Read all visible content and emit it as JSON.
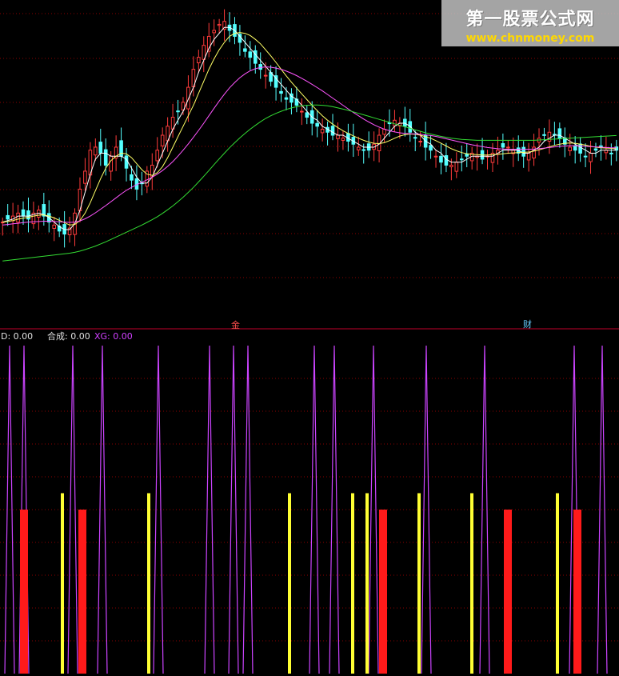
{
  "watermark": {
    "title": "第一股票公式网",
    "url": "www.chnmoney.com"
  },
  "markers": {
    "left": "金",
    "right": "财"
  },
  "indicator_header": {
    "d_label": "D: 0.00",
    "hecheng_label": "合成: 0.00",
    "xg_label": "XG: 0.00"
  },
  "colors": {
    "background": "#000000",
    "candle_up": "#ff3b3b",
    "candle_down": "#54ffff",
    "ma_short": "#ffffff",
    "ma_mid": "#ffff66",
    "ma_long": "#ff55ff",
    "ma_very_long": "#33dd33",
    "grid": "#8b0000",
    "spike_line": "#cc44ff",
    "signal_yellow": "#ffff33",
    "signal_red": "#ff1a1a"
  },
  "chart_data": [
    {
      "type": "candlestick",
      "title": "",
      "grid": true,
      "series": [
        {
          "name": "price",
          "close": [
            33,
            34,
            35,
            36,
            35,
            34,
            36,
            37,
            35,
            33,
            32,
            30,
            29,
            31,
            36,
            44,
            50,
            57,
            58,
            56,
            52,
            55,
            58,
            55,
            51,
            47,
            44,
            46,
            50,
            52,
            57,
            62,
            65,
            68,
            70,
            73,
            78,
            84,
            88,
            92,
            95,
            97,
            99,
            100,
            97,
            95,
            93,
            90,
            88,
            86,
            84,
            82,
            80,
            78,
            76,
            74,
            73,
            72,
            70,
            68,
            66,
            65,
            64,
            63,
            62,
            62,
            61,
            60,
            59,
            58,
            57,
            57,
            59,
            62,
            64,
            66,
            67,
            66,
            65,
            63,
            61,
            60,
            58,
            57,
            55,
            53,
            52,
            52,
            53,
            54,
            55,
            56,
            55,
            54,
            55,
            56,
            57,
            58,
            58,
            57,
            56,
            55,
            56,
            58,
            61,
            62,
            63,
            62,
            61,
            59,
            58,
            57,
            56,
            55,
            56,
            57,
            58,
            57,
            56,
            57
          ]
        },
        {
          "name": "ma_short",
          "values": [
            33,
            33.5,
            34,
            35,
            35,
            35,
            35.5,
            36,
            35.5,
            34.5,
            33,
            31.5,
            30.5,
            30.5,
            32.5,
            37,
            43,
            49,
            54,
            56,
            56,
            55,
            55,
            55,
            54,
            51,
            48,
            46,
            46,
            48,
            52,
            56,
            60,
            64,
            67,
            70,
            74,
            78,
            83,
            87,
            91,
            94,
            96,
            98,
            98,
            97,
            95,
            93,
            91,
            89,
            87,
            85,
            83,
            81,
            79,
            77,
            75,
            74,
            72,
            70,
            68,
            67,
            65,
            64,
            63,
            62,
            62,
            61,
            60,
            59,
            58,
            58,
            58,
            59,
            61,
            63,
            65,
            66,
            66,
            65,
            63,
            62,
            60,
            59,
            57,
            56,
            54,
            53,
            53,
            53,
            54,
            55,
            55,
            55,
            55,
            55,
            56,
            57,
            57,
            57,
            57,
            56,
            56,
            57,
            58,
            60,
            61,
            62,
            62,
            61,
            60,
            59,
            58,
            57,
            56,
            56,
            57,
            57,
            57,
            57
          ]
        },
        {
          "name": "ma_mid",
          "values": [
            33,
            33.2,
            33.5,
            34,
            34.3,
            34.6,
            35,
            35.3,
            35.4,
            35,
            34.4,
            33.6,
            32.8,
            32,
            32.2,
            33.5,
            36,
            39.5,
            43.5,
            47.5,
            51,
            53.5,
            55,
            56,
            55.8,
            54.5,
            52.5,
            50.5,
            49,
            48.6,
            49.5,
            51.5,
            54.5,
            58,
            61.5,
            65,
            68.5,
            72,
            76,
            80,
            84,
            87.5,
            90.5,
            93,
            95,
            96,
            96.3,
            96,
            95.3,
            94,
            92.5,
            90.5,
            88.5,
            86.3,
            84,
            81.8,
            79.7,
            77.7,
            75.8,
            73.9,
            72,
            70.2,
            68.5,
            67,
            65.7,
            64.5,
            63.5,
            62.6,
            61.8,
            61,
            60.3,
            59.7,
            59.3,
            59.2,
            59.5,
            60.2,
            61,
            61.7,
            62.2,
            62.4,
            62.3,
            62,
            61.5,
            61,
            60.2,
            59.3,
            58.4,
            57.5,
            56.8,
            56.2,
            55.8,
            55.6,
            55.5,
            55.4,
            55.4,
            55.5,
            55.6,
            55.8,
            56,
            56.1,
            56.2,
            56.3,
            56.4,
            56.7,
            57.1,
            57.6,
            58.1,
            58.6,
            59,
            59.3,
            59.4,
            59.3,
            59,
            58.7,
            58.3,
            58,
            57.8,
            57.7,
            57.6,
            57.5
          ]
        },
        {
          "name": "ma_long",
          "values": [
            32,
            32.2,
            32.4,
            32.6,
            32.8,
            33,
            33.1,
            33.2,
            33.3,
            33.3,
            33.2,
            33.1,
            33,
            32.9,
            33,
            33.4,
            34.1,
            35,
            36.1,
            37.3,
            38.5,
            39.8,
            41.1,
            42.4,
            43.6,
            44.6,
            45.5,
            46.3,
            47.1,
            48,
            49,
            50.2,
            51.6,
            53.2,
            55,
            57,
            59.1,
            61.3,
            63.6,
            66,
            68.5,
            71,
            73.4,
            75.7,
            77.8,
            79.6,
            81.2,
            82.5,
            83.5,
            84.2,
            84.6,
            84.8,
            84.7,
            84.4,
            84,
            83.4,
            82.7,
            81.9,
            81,
            80,
            79,
            77.9,
            76.8,
            75.6,
            74.4,
            73.2,
            72,
            70.8,
            69.6,
            68.5,
            67.4,
            66.4,
            65.5,
            64.7,
            64,
            63.5,
            63.1,
            62.8,
            62.6,
            62.5,
            62.4,
            62.3,
            62.1,
            61.9,
            61.6,
            61.2,
            60.8,
            60.4,
            60,
            59.6,
            59.2,
            58.8,
            58.5,
            58.2,
            57.9,
            57.7,
            57.5,
            57.4,
            57.3,
            57.3,
            57.3,
            57.3,
            57.3,
            57.4,
            57.5,
            57.7,
            57.9,
            58.1,
            58.3,
            58.4,
            58.5,
            58.5,
            58.4,
            58.3,
            58.2,
            58.1,
            58,
            57.9,
            57.8,
            57.8
          ]
        },
        {
          "name": "ma_very_long",
          "values": [
            20,
            20.2,
            20.4,
            20.6,
            20.8,
            21,
            21.2,
            21.4,
            21.6,
            21.8,
            22,
            22.2,
            22.4,
            22.6,
            22.9,
            23.3,
            23.8,
            24.4,
            25,
            25.7,
            26.4,
            27.2,
            28,
            28.8,
            29.6,
            30.4,
            31.2,
            32,
            32.9,
            33.8,
            34.8,
            35.9,
            37.1,
            38.4,
            39.8,
            41.3,
            42.9,
            44.6,
            46.4,
            48.3,
            50.2,
            52.2,
            54.1,
            56,
            57.8,
            59.5,
            61.1,
            62.6,
            64,
            65.3,
            66.5,
            67.6,
            68.5,
            69.3,
            70,
            70.6,
            71.1,
            71.5,
            71.8,
            72,
            72.1,
            72.1,
            72,
            71.8,
            71.5,
            71.1,
            70.7,
            70.3,
            69.8,
            69.3,
            68.8,
            68.3,
            67.8,
            67.3,
            66.8,
            66.3,
            65.8,
            65.3,
            64.8,
            64.3,
            63.8,
            63.3,
            62.8,
            62.4,
            62,
            61.6,
            61.3,
            61,
            60.8,
            60.6,
            60.5,
            60.4,
            60.3,
            60.3,
            60.3,
            60.3,
            60.3,
            60.3,
            60.3,
            60.3,
            60.3,
            60.3,
            60.3,
            60.3,
            60.4,
            60.5,
            60.6,
            60.7,
            60.8,
            60.9,
            61,
            61.1,
            61.2,
            61.3,
            61.4,
            61.5,
            61.6,
            61.7,
            61.8,
            61.9
          ]
        }
      ]
    },
    {
      "type": "bar",
      "title": "",
      "grid": true,
      "series": [
        {
          "name": "spikes",
          "x": [
            12,
            30,
            91,
            128,
            198,
            262,
            292,
            310,
            393,
            418,
            467,
            533,
            606,
            718,
            753
          ],
          "value": 1.0
        },
        {
          "name": "yellow",
          "x": [
            78,
            186,
            362,
            441,
            459,
            524,
            590,
            697
          ],
          "value": 0.55
        },
        {
          "name": "red",
          "x": [
            30,
            103,
            479,
            635,
            722
          ],
          "value": 0.5
        }
      ]
    }
  ]
}
